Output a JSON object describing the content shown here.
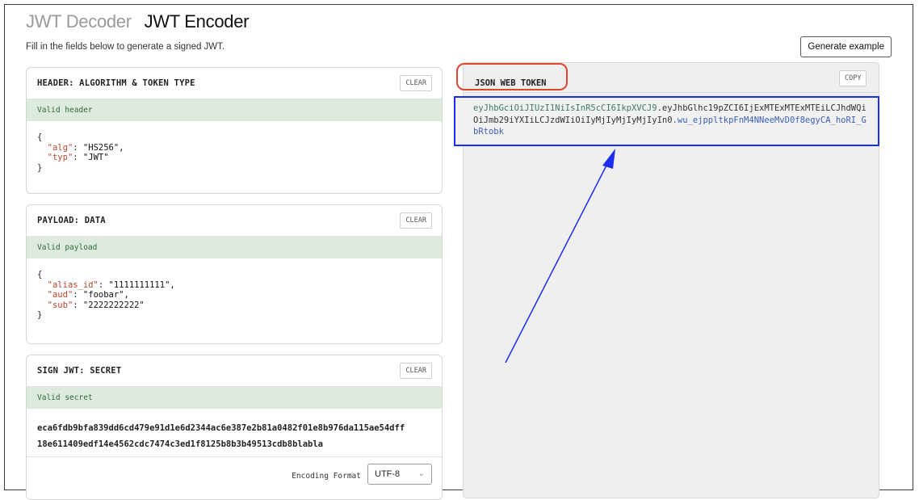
{
  "nav": {
    "decoder_label": "JWT Decoder",
    "encoder_label": "JWT Encoder"
  },
  "subtitle": "Fill in the fields below to generate a signed JWT.",
  "generate_button": "Generate example",
  "header_panel": {
    "title": "HEADER: ALGORITHM & TOKEN TYPE",
    "clear_label": "CLEAR",
    "status": "Valid header",
    "json": {
      "open": "{",
      "close": "}",
      "lines": [
        {
          "key": "\"alg\"",
          "value": "\"HS256\","
        },
        {
          "key": "\"typ\"",
          "value": "\"JWT\""
        }
      ]
    }
  },
  "payload_panel": {
    "title": "PAYLOAD: DATA",
    "clear_label": "CLEAR",
    "status": "Valid payload",
    "json": {
      "open": "{",
      "close": "}",
      "lines": [
        {
          "key": "\"alias_id\"",
          "value": "\"1111111111\","
        },
        {
          "key": "\"aud\"",
          "value": "\"foobar\","
        },
        {
          "key": "\"sub\"",
          "value": "\"2222222222\""
        }
      ]
    }
  },
  "secret_panel": {
    "title": "SIGN JWT: SECRET",
    "clear_label": "CLEAR",
    "status": "Valid secret",
    "secret_line1": "eca6fdb9bfa839dd6cd479e91d1e6d2344ac6e387e2b81a0482f01e8b976da115ae54dff",
    "secret_line2": "18e611409edf14e4562cdc7474c3ed1f8125b8b3b49513cdb8blabla",
    "encoding_label": "Encoding Format",
    "encoding_value": "UTF-8"
  },
  "jwt_panel": {
    "title": "JSON WEB TOKEN",
    "copy_label": "COPY",
    "token_header": "eyJhbGciOiJIUzI1NiIsInR5cCI6IkpXVCJ9",
    "dot1": ".",
    "token_payload": "eyJhbGlhc19pZCI6IjExMTExMTExMTEiLCJhdWQiOiJmb29iYXIiLCJzdWIiOiIyMjIyMjIyMjIyIn0",
    "dot2": ".",
    "token_signature": "wu_ejppltkpFnM4NNeeMvD0f8egyCA_hoRI_GbRtobk"
  },
  "colors": {
    "highlight_red": "#e2452f",
    "highlight_blue": "#1b2ef0",
    "valid_bg": "#dcebdd"
  }
}
